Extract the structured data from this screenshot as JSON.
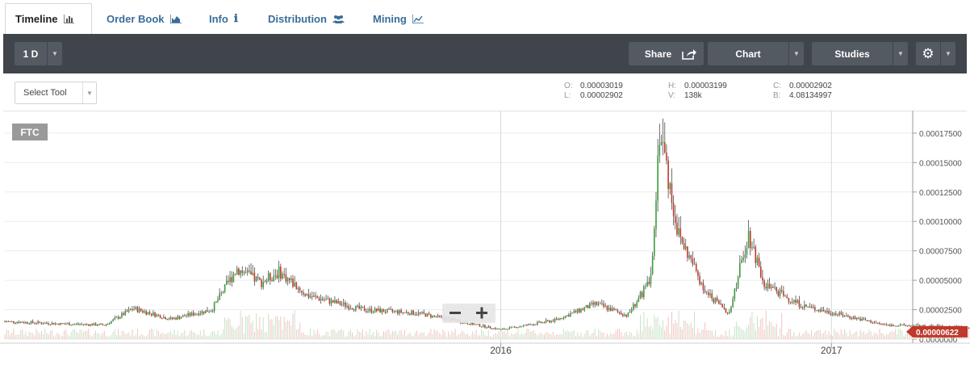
{
  "tabs": [
    {
      "label": "Timeline",
      "icon": "bar-chart-icon",
      "active": true
    },
    {
      "label": "Order Book",
      "icon": "area-chart-icon",
      "active": false
    },
    {
      "label": "Info",
      "icon": "info-icon",
      "active": false
    },
    {
      "label": "Distribution",
      "icon": "users-icon",
      "active": false
    },
    {
      "label": "Mining",
      "icon": "line-chart-icon",
      "active": false
    }
  ],
  "toolbar": {
    "interval": "1 D",
    "share_label": "Share",
    "chart_label": "Chart",
    "studies_label": "Studies",
    "settings_icon": "gear-icon"
  },
  "subbar": {
    "select_tool": "Select Tool"
  },
  "ohlc": {
    "o_label": "O:",
    "o_value": "0.00003019",
    "l_label": "L:",
    "l_value": "0.00002902",
    "h_label": "H:",
    "h_value": "0.00003199",
    "v_label": "V:",
    "v_value": "138k",
    "c_label": "C:",
    "c_value": "0.00002902",
    "b_label": "B:",
    "b_value": "4.08134997"
  },
  "colors": {
    "accent": "#3a6d9a",
    "toolbar_bg": "#3f454b",
    "up": "#3c9a3c",
    "down": "#c0392b",
    "price_tag": "#c0392b"
  },
  "chart_data": {
    "type": "candlestick",
    "symbol": "FTC",
    "last_price": "0.00000622",
    "x_ticks": [
      "2016",
      "2017"
    ],
    "y_ticks": [
      "0.0000000",
      "0.00002500",
      "0.00005000",
      "0.00007500",
      "0.00010000",
      "0.00012500",
      "0.00015000",
      "0.00017500"
    ],
    "ylim": [
      0,
      0.00019
    ],
    "xlim": [
      "2014-07",
      "2017-04"
    ],
    "grid": true,
    "close_series": [
      {
        "x": "2014-07-01",
        "y": 1.5e-05
      },
      {
        "x": "2014-09-01",
        "y": 1.3e-05
      },
      {
        "x": "2014-10-20",
        "y": 1.2e-05
      },
      {
        "x": "2014-11-20",
        "y": 2.6e-05
      },
      {
        "x": "2015-01-01",
        "y": 1.7e-05
      },
      {
        "x": "2015-02-15",
        "y": 2.5e-05
      },
      {
        "x": "2015-03-15",
        "y": 6e-05
      },
      {
        "x": "2015-04-10",
        "y": 4.8e-05
      },
      {
        "x": "2015-05-01",
        "y": 5.7e-05
      },
      {
        "x": "2015-06-01",
        "y": 3.7e-05
      },
      {
        "x": "2015-08-01",
        "y": 2.5e-05
      },
      {
        "x": "2015-10-01",
        "y": 2.2e-05
      },
      {
        "x": "2016-01-01",
        "y": 8e-06
      },
      {
        "x": "2016-03-01",
        "y": 1.6e-05
      },
      {
        "x": "2016-04-15",
        "y": 3e-05
      },
      {
        "x": "2016-05-20",
        "y": 2e-05
      },
      {
        "x": "2016-06-15",
        "y": 5e-05
      },
      {
        "x": "2016-06-25",
        "y": 0.00018
      },
      {
        "x": "2016-07-15",
        "y": 9e-05
      },
      {
        "x": "2016-08-15",
        "y": 4e-05
      },
      {
        "x": "2016-09-10",
        "y": 2.2e-05
      },
      {
        "x": "2016-10-01",
        "y": 9e-05
      },
      {
        "x": "2016-10-20",
        "y": 4.5e-05
      },
      {
        "x": "2016-12-01",
        "y": 2.8e-05
      },
      {
        "x": "2017-03-01",
        "y": 1.2e-05
      },
      {
        "x": "2017-06-01",
        "y": 1e-05
      },
      {
        "x": "2017-07-15",
        "y": 6e-06
      }
    ]
  }
}
